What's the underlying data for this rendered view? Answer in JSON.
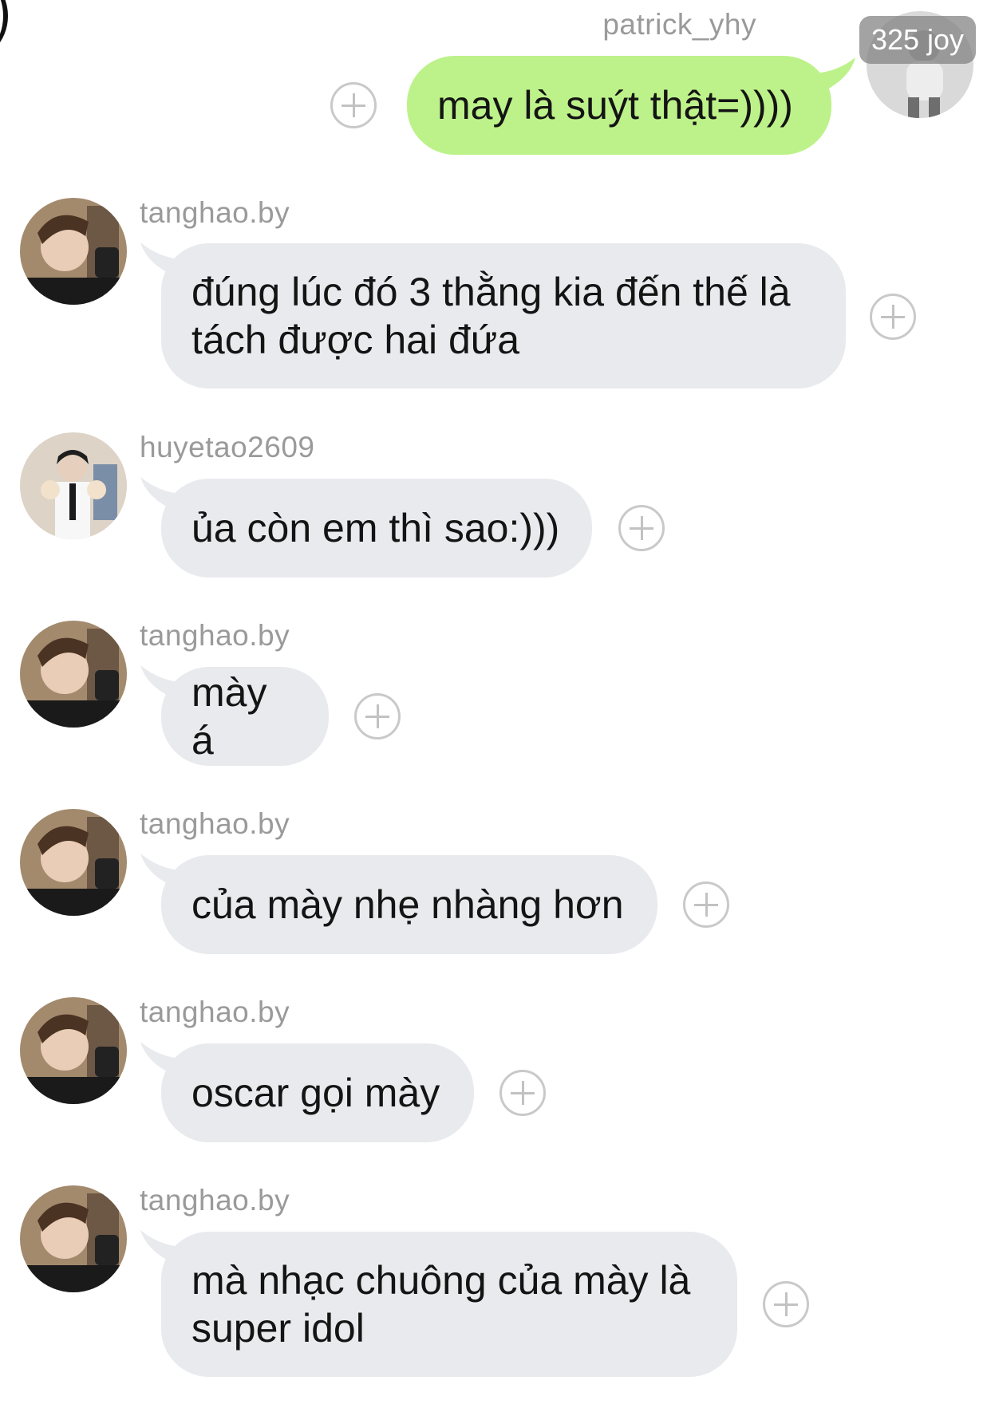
{
  "messages": [
    {
      "sender": "patrick_yhy",
      "text": "may là suýt thật=))))",
      "outgoing": true,
      "avatar": "photo-grayscale-person"
    },
    {
      "sender": "tanghao.by",
      "text": "đúng lúc đó 3 thằng kia đến thế là\ntách được hai đứa",
      "outgoing": false,
      "avatar": "photo-man-selfie"
    },
    {
      "sender": "huyetao2609",
      "text": "ủa còn em thì sao:)))",
      "outgoing": false,
      "avatar": "photo-person-with-plush"
    },
    {
      "sender": "tanghao.by",
      "text": "mày á",
      "outgoing": false,
      "avatar": "photo-man-selfie"
    },
    {
      "sender": "tanghao.by",
      "text": "của mày nhẹ nhàng hơn",
      "outgoing": false,
      "avatar": "photo-man-selfie"
    },
    {
      "sender": "tanghao.by",
      "text": "oscar gọi mày",
      "outgoing": false,
      "avatar": "photo-man-selfie"
    },
    {
      "sender": "tanghao.by",
      "text": "mà nhạc chuông của mày là\nsuper idol",
      "outgoing": false,
      "avatar": "photo-man-selfie"
    }
  ],
  "overlay_badge": "325 joy",
  "colors": {
    "incoming_bubble": "#e8eaed",
    "outgoing_bubble": "#bdf28a",
    "username_text": "#9a9a9a",
    "message_text": "#141414",
    "add_icon": "#c9c9c9"
  },
  "icons": {
    "add_reaction": "plus-circle-icon"
  }
}
